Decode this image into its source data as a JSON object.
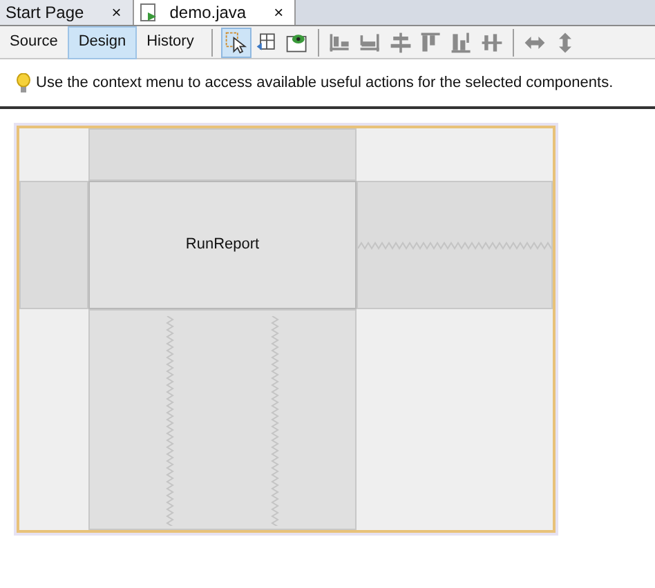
{
  "file_tabs": [
    {
      "label": "Start Page",
      "close": "×",
      "selected": false,
      "kind": "plain"
    },
    {
      "label": "demo.java",
      "close": "×",
      "selected": true,
      "kind": "java"
    }
  ],
  "view_tabs": [
    {
      "label": "Source",
      "selected": false
    },
    {
      "label": "Design",
      "selected": true
    },
    {
      "label": "History",
      "selected": false
    }
  ],
  "tools": [
    {
      "kind": "selection",
      "selected": true
    },
    {
      "kind": "connection",
      "selected": false
    },
    {
      "kind": "preview",
      "selected": false
    },
    {
      "kind": "sep"
    },
    {
      "kind": "align-left",
      "selected": false
    },
    {
      "kind": "align-right",
      "selected": false
    },
    {
      "kind": "center-h",
      "selected": false
    },
    {
      "kind": "align-top",
      "selected": false
    },
    {
      "kind": "align-bottom",
      "selected": false
    },
    {
      "kind": "center-v",
      "selected": false
    },
    {
      "kind": "sep"
    },
    {
      "kind": "resize-h",
      "selected": false
    },
    {
      "kind": "resize-v",
      "selected": false
    }
  ],
  "hint": "Use the context menu to access available useful actions for the selected components.",
  "form": {
    "button": "RunReport"
  }
}
